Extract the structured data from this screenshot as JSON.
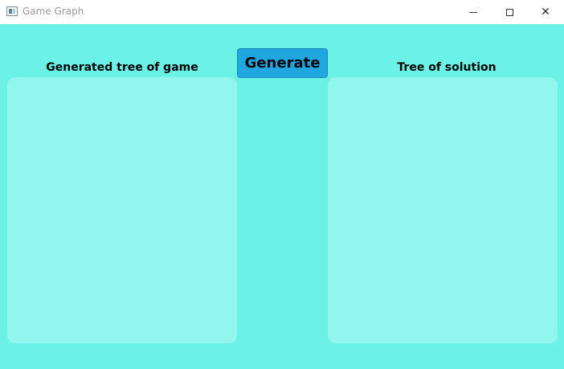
{
  "window": {
    "title": "Game Graph",
    "controls": {
      "minimize": "minimize-icon",
      "maximize": "maximize-icon",
      "close": "close-icon",
      "close_glyph": "✕"
    }
  },
  "main": {
    "generate_label": "Generate",
    "left_panel_title": "Generated tree of game",
    "right_panel_title": "Tree of solution"
  },
  "colors": {
    "background": "#6cf1e7",
    "panel": "#91f6ee",
    "button": "#21a7e0"
  }
}
